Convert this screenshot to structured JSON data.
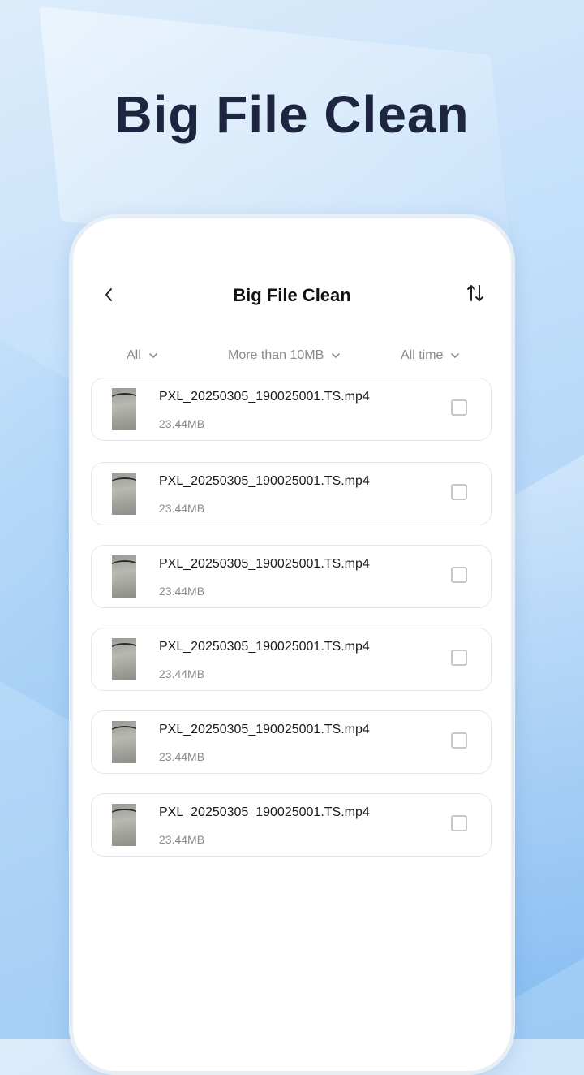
{
  "headline": "Big File Clean",
  "header": {
    "title": "Big File Clean",
    "back_icon": "chevron-left-icon",
    "sort_icon": "sort-arrows-icon"
  },
  "filters": [
    {
      "label": "All"
    },
    {
      "label": "More than 10MB"
    },
    {
      "label": "All time"
    }
  ],
  "files": [
    {
      "name": "PXL_20250305_190025001.TS.mp4",
      "size": "23.44MB",
      "checked": false
    },
    {
      "name": "PXL_20250305_190025001.TS.mp4",
      "size": "23.44MB",
      "checked": false
    },
    {
      "name": "PXL_20250305_190025001.TS.mp4",
      "size": "23.44MB",
      "checked": false
    },
    {
      "name": "PXL_20250305_190025001.TS.mp4",
      "size": "23.44MB",
      "checked": false
    },
    {
      "name": "PXL_20250305_190025001.TS.mp4",
      "size": "23.44MB",
      "checked": false
    },
    {
      "name": "PXL_20250305_190025001.TS.mp4",
      "size": "23.44MB",
      "checked": false
    }
  ],
  "colors": {
    "headline": "#1d2540",
    "accent_bg": "#b3d6f7",
    "checkbox_border": "#c4c7cc"
  }
}
